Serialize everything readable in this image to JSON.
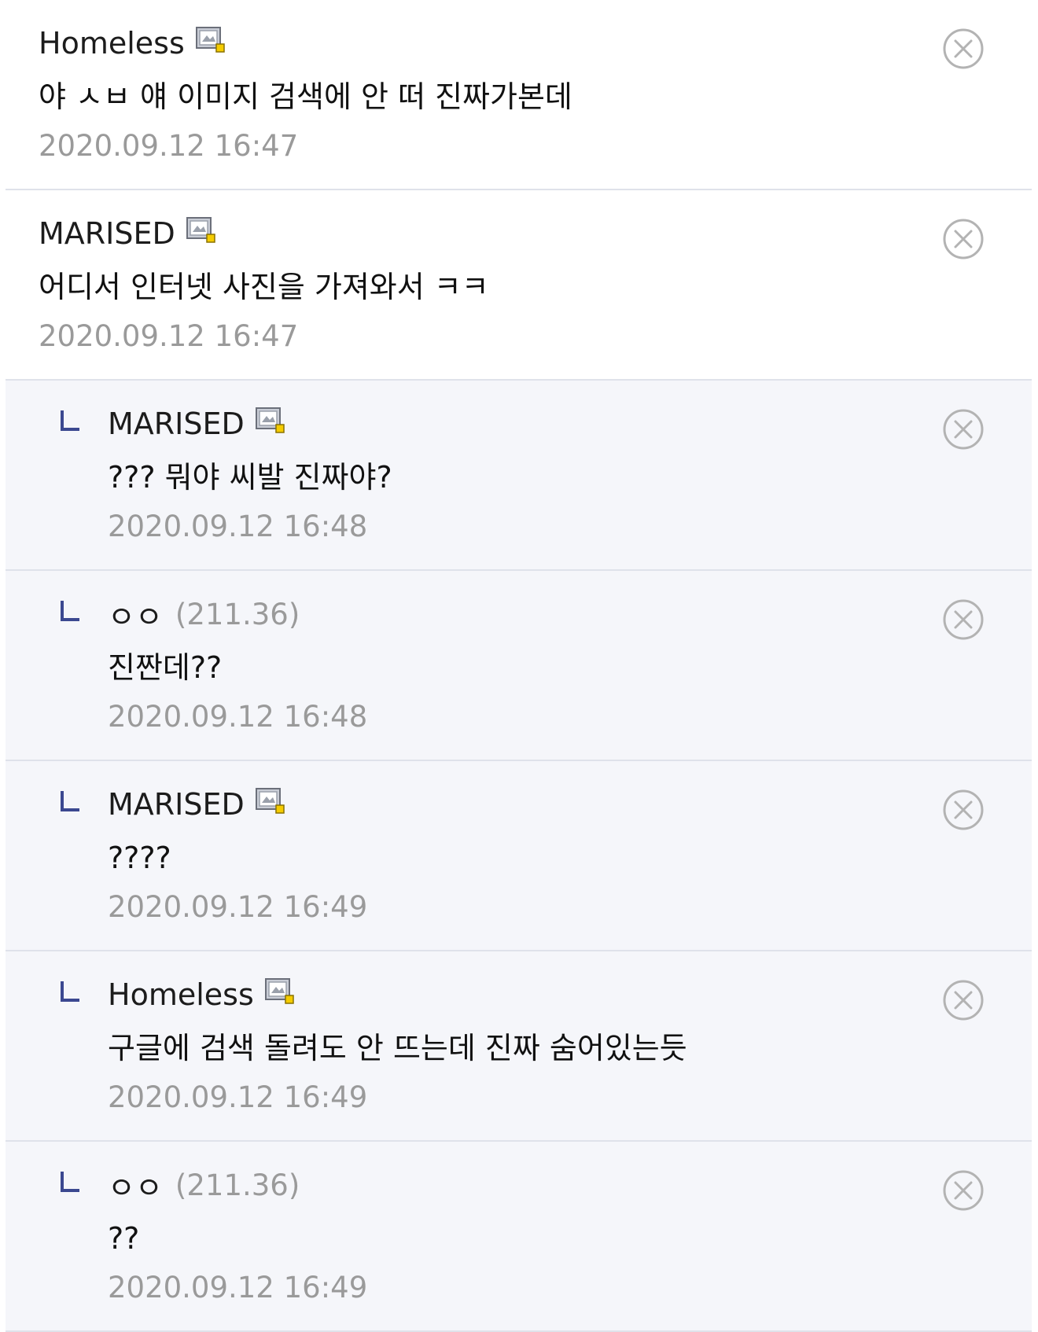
{
  "comments": [
    {
      "nickname": "Homeless",
      "ip": "",
      "text": "야 ㅅㅂ 얘 이미지 검색에 안 떠 진짜가본데",
      "date": "2020.09.12 16:47",
      "reply": false,
      "fixed_user": true
    },
    {
      "nickname": "MARISED",
      "ip": "",
      "text": "어디서 인터넷 사진을 가져와서 ㅋㅋ",
      "date": "2020.09.12 16:47",
      "reply": false,
      "fixed_user": true
    },
    {
      "nickname": "MARISED",
      "ip": "",
      "text": "??? 뭐야 씨발 진짜야?",
      "date": "2020.09.12 16:48",
      "reply": true,
      "fixed_user": true
    },
    {
      "nickname": "ㅇㅇ",
      "ip": "(211.36)",
      "text": "진짠데??",
      "date": "2020.09.12 16:48",
      "reply": true,
      "fixed_user": false
    },
    {
      "nickname": "MARISED",
      "ip": "",
      "text": "????",
      "date": "2020.09.12 16:49",
      "reply": true,
      "fixed_user": true
    },
    {
      "nickname": "Homeless",
      "ip": "",
      "text": "구글에 검색 돌려도 안 뜨는데 진짜 숨어있는듯",
      "date": "2020.09.12 16:49",
      "reply": true,
      "fixed_user": true
    },
    {
      "nickname": "ㅇㅇ",
      "ip": "(211.36)",
      "text": "??",
      "date": "2020.09.12 16:49",
      "reply": true,
      "fixed_user": false
    }
  ],
  "icons": {
    "delete": "close-circle-icon",
    "reply": "reply-arrow-icon",
    "fixed_user": "fixed-nick-icon"
  },
  "colors": {
    "reply_background": "#f5f6fa",
    "reply_mark": "#3b4890",
    "divider": "#dfe2ea",
    "muted_text": "#9a9a9a"
  }
}
